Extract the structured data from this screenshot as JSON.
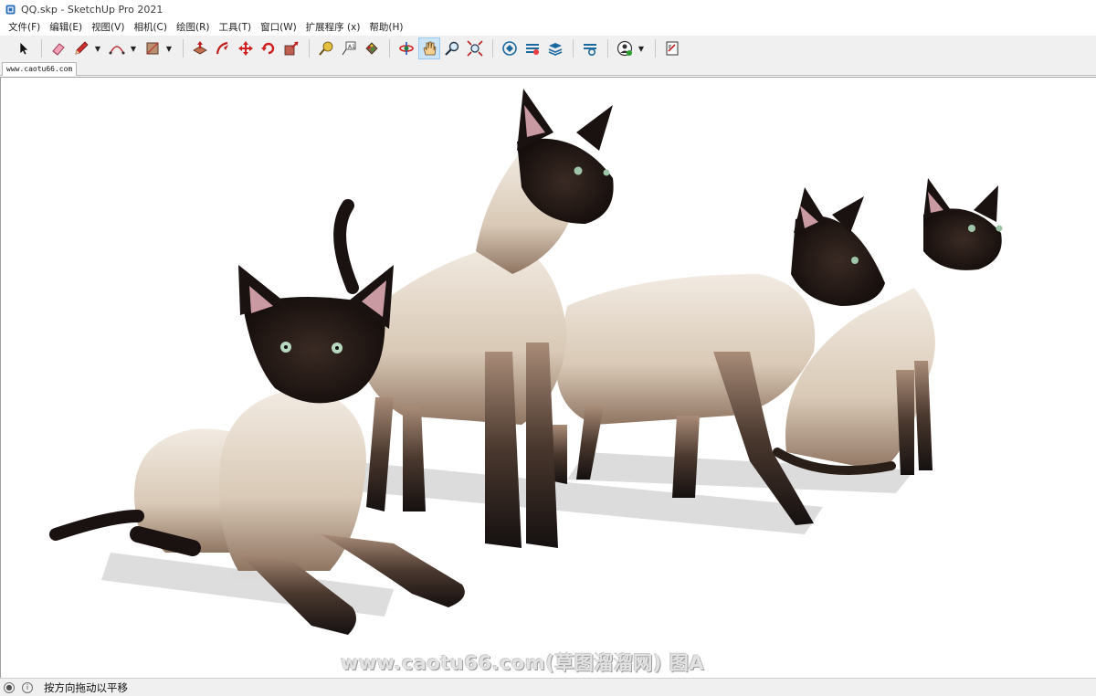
{
  "window": {
    "title": "QQ.skp - SketchUp Pro 2021",
    "app_icon": "sketchup-logo-icon"
  },
  "menu": [
    {
      "label": "文件(F)"
    },
    {
      "label": "编辑(E)"
    },
    {
      "label": "视图(V)"
    },
    {
      "label": "相机(C)"
    },
    {
      "label": "绘图(R)"
    },
    {
      "label": "工具(T)"
    },
    {
      "label": "窗口(W)"
    },
    {
      "label": "扩展程序 (x)"
    },
    {
      "label": "帮助(H)"
    }
  ],
  "toolbar": {
    "tools": [
      {
        "name": "select-tool",
        "icon": "arrow-cursor-icon"
      },
      {
        "name": "eraser-tool",
        "icon": "eraser-icon"
      },
      {
        "name": "line-tool",
        "icon": "pencil-icon",
        "dropdown": true
      },
      {
        "name": "arc-tool",
        "icon": "arc-icon",
        "dropdown": true
      },
      {
        "name": "rectangle-tool",
        "icon": "rectangle-icon",
        "dropdown": true
      },
      {
        "name": "push-pull-tool",
        "icon": "push-pull-icon"
      },
      {
        "name": "follow-me-tool",
        "icon": "follow-me-icon"
      },
      {
        "name": "move-tool",
        "icon": "move-icon"
      },
      {
        "name": "rotate-tool",
        "icon": "rotate-icon"
      },
      {
        "name": "scale-tool",
        "icon": "scale-icon"
      },
      {
        "name": "tape-measure-tool",
        "icon": "tape-measure-icon"
      },
      {
        "name": "text-tool",
        "icon": "text-icon"
      },
      {
        "name": "paint-bucket-tool",
        "icon": "paint-bucket-icon"
      },
      {
        "name": "orbit-tool",
        "icon": "orbit-icon"
      },
      {
        "name": "pan-tool",
        "icon": "pan-hand-icon",
        "active": true
      },
      {
        "name": "zoom-tool",
        "icon": "zoom-icon"
      },
      {
        "name": "zoom-extents-tool",
        "icon": "zoom-extents-icon"
      },
      {
        "name": "3d-warehouse-button",
        "icon": "warehouse-icon"
      },
      {
        "name": "extension-warehouse-button",
        "icon": "extension-warehouse-icon"
      },
      {
        "name": "layout-button",
        "icon": "layers-send-icon"
      },
      {
        "name": "extension-manager-button",
        "icon": "extension-manager-icon"
      },
      {
        "name": "account-button",
        "icon": "user-account-icon",
        "dropdown": true
      },
      {
        "name": "send-to-layout-button",
        "icon": "layout-doc-icon"
      }
    ],
    "active_color": "#cce4f7"
  },
  "scene_tabs": [
    {
      "label": "www.caotu66.com"
    }
  ],
  "viewport": {
    "background": "#ffffff",
    "content": "five-siamese-cats-model",
    "watermark": "www.caotu66.com(草图溜溜网) 图A"
  },
  "statusbar": {
    "icons": [
      "geo-location-icon",
      "info-icon"
    ],
    "message": "按方向拖动以平移"
  }
}
